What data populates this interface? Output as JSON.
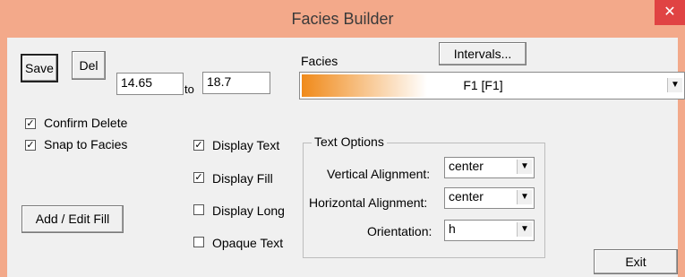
{
  "window": {
    "title": "Facies Builder",
    "close_glyph": "✕"
  },
  "buttons": {
    "save": "Save",
    "del": "Del",
    "intervals": "Intervals...",
    "add_edit_fill": "Add / Edit Fill",
    "exit": "Exit"
  },
  "range": {
    "from": "14.65",
    "to_label": "to",
    "to": "18.7"
  },
  "facies": {
    "label": "Facies",
    "selected": "F1 [F1]",
    "swatch_color": "#f08a1a"
  },
  "checkboxes": {
    "confirm_delete": {
      "label": "Confirm Delete",
      "checked": true
    },
    "snap_to_facies": {
      "label": "Snap to Facies",
      "checked": true
    },
    "display_text": {
      "label": "Display Text",
      "checked": true
    },
    "display_fill": {
      "label": "Display Fill",
      "checked": true
    },
    "display_long": {
      "label": "Display Long",
      "checked": false
    },
    "opaque_text": {
      "label": "Opaque Text",
      "checked": false
    }
  },
  "text_options": {
    "title": "Text Options",
    "vertical_label": "Vertical Alignment:",
    "vertical_value": "center",
    "horizontal_label": "Horizontal Alignment:",
    "horizontal_value": "center",
    "orientation_label": "Orientation:",
    "orientation_value": "h"
  },
  "glyphs": {
    "check": "✓",
    "arrow": "▼"
  }
}
